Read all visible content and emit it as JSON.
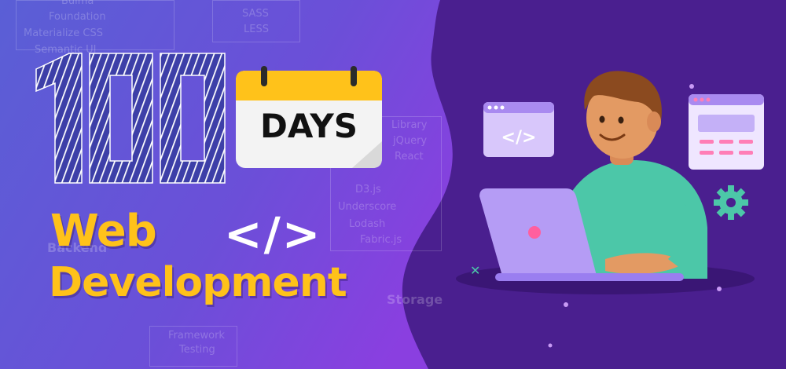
{
  "banner": {
    "hero_number": "100",
    "calendar_label": "DAYS",
    "heading_line1": "Web",
    "heading_code_symbol": "</>",
    "heading_line2": "Development",
    "browser_code_symbol": "</>",
    "background_labels": [
      "Bulma",
      "Foundation",
      "Materialize CSS",
      "Semantic UI",
      "SASS",
      "LESS",
      "Library",
      "jQuery",
      "React",
      "D3.js",
      "Underscore",
      "Lodash",
      "Fabric.js",
      "Backend",
      "Storage",
      "Framework",
      "Testing"
    ]
  },
  "colors": {
    "accent_yellow": "#ffc21a",
    "purple_dark": "#4a1f8f",
    "purple_mid": "#7b3fe4",
    "laptop_lilac": "#b59cf5",
    "shirt_teal": "#4cc7a8"
  },
  "icons": [
    "calendar-icon",
    "browser-code-window-icon",
    "form-window-icon",
    "gear-icon",
    "laptop-icon",
    "developer-avatar"
  ]
}
